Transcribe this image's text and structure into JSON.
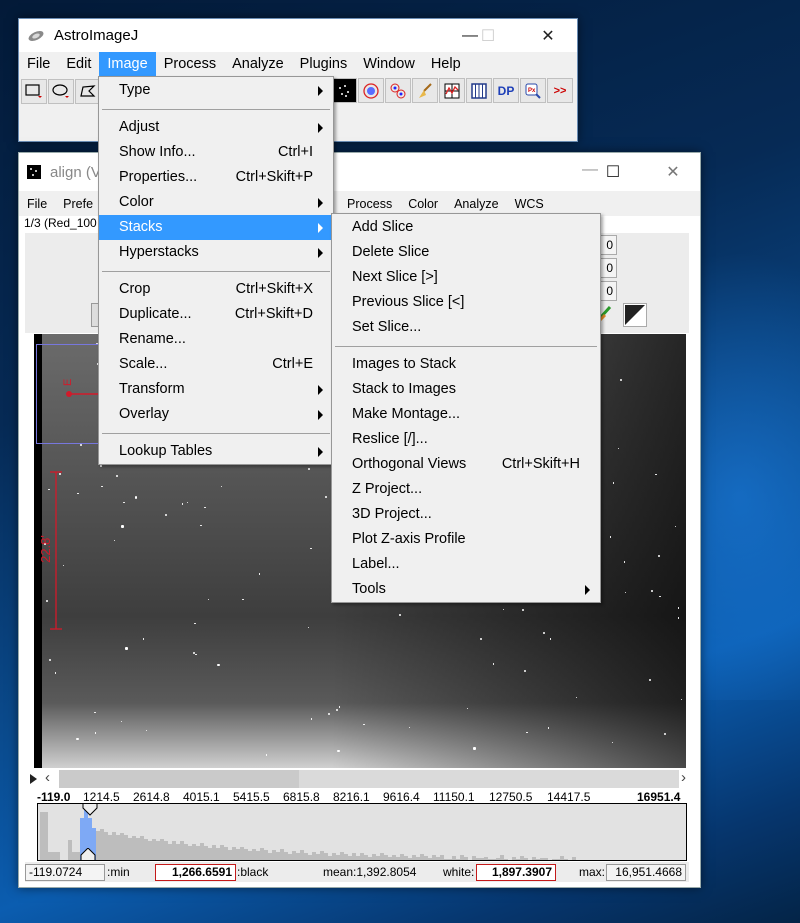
{
  "main_window": {
    "title": "AstroImageJ",
    "menubar": [
      "File",
      "Edit",
      "Image",
      "Process",
      "Analyze",
      "Plugins",
      "Window",
      "Help"
    ],
    "active_menu": "Image",
    "toolbar_icons": [
      "rectangle-tool",
      "oval-tool",
      "polygon-tool",
      "star-field-tool",
      "aperture-tool",
      "multi-aperture-tool",
      "clear-overlay-tool",
      "plot-tool",
      "table-tool",
      "dp-tool",
      "pixel-zoom-tool",
      "more-tools"
    ],
    "toolbar_labels": {
      "dp": "DP",
      "px": "Px",
      "more": ">>"
    }
  },
  "image_menu": {
    "items": [
      {
        "label": "Type",
        "submenu": true
      },
      {
        "separator": true
      },
      {
        "label": "Adjust",
        "submenu": true
      },
      {
        "label": "Show Info...",
        "shortcut": "Ctrl+I"
      },
      {
        "label": "Properties...",
        "shortcut": "Ctrl+Skift+P"
      },
      {
        "label": "Color",
        "submenu": true
      },
      {
        "label": "Stacks",
        "submenu": true,
        "highlighted": true
      },
      {
        "label": "Hyperstacks",
        "submenu": true
      },
      {
        "separator": true
      },
      {
        "label": "Crop",
        "shortcut": "Ctrl+Skift+X"
      },
      {
        "label": "Duplicate...",
        "shortcut": "Ctrl+Skift+D"
      },
      {
        "label": "Rename..."
      },
      {
        "label": "Scale...",
        "shortcut": "Ctrl+E"
      },
      {
        "label": "Transform",
        "submenu": true
      },
      {
        "label": "Overlay",
        "submenu": true
      },
      {
        "separator": true
      },
      {
        "label": "Lookup Tables",
        "submenu": true
      }
    ]
  },
  "stacks_menu": {
    "items": [
      {
        "label": "Add Slice"
      },
      {
        "label": "Delete Slice"
      },
      {
        "label": "Next Slice [>]"
      },
      {
        "label": "Previous Slice [<]"
      },
      {
        "label": "Set Slice..."
      },
      {
        "separator": true
      },
      {
        "label": "Images to Stack"
      },
      {
        "label": "Stack to Images"
      },
      {
        "label": "Make Montage..."
      },
      {
        "label": "Reslice [/]..."
      },
      {
        "label": "Orthogonal Views",
        "shortcut": "Ctrl+Skift+H"
      },
      {
        "label": "Z Project..."
      },
      {
        "label": "3D Project..."
      },
      {
        "label": "Plot Z-axis Profile"
      },
      {
        "label": "Label..."
      },
      {
        "label": "Tools",
        "submenu": true
      }
    ]
  },
  "image_window": {
    "title": "align (V",
    "menubar_left": [
      "File",
      "Prefe"
    ],
    "menubar_right": [
      "Process",
      "Color",
      "Analyze",
      "WCS"
    ],
    "slice_label": "1/3 (Red_100",
    "num_boxes": [
      "0",
      "0",
      "0"
    ],
    "overlay": {
      "north_label": "E",
      "scale_label": "22.8'"
    },
    "histogram": {
      "tick_labels": [
        "-119.0",
        "1214.5",
        "2614.8",
        "4015.1",
        "5415.5",
        "6815.8",
        "8216.1",
        "9616.4",
        "11150.1",
        "12750.5",
        "14417.5",
        "16951.4"
      ],
      "min_value": "-119.0724",
      "min_label": ":min",
      "black_value": "1,266.6591",
      "black_label": ":black",
      "mean_text": "mean:1,392.8054",
      "white_label": "white:",
      "white_value": "1,897.3907",
      "max_label": "max:",
      "max_value": "16,951.4668"
    }
  },
  "colors": {
    "menu_highlight": "#3399ff",
    "histogram_selected": "#7ea9f5",
    "overlay_red": "#d21a2a",
    "value_box_border": "#c41a1a"
  }
}
